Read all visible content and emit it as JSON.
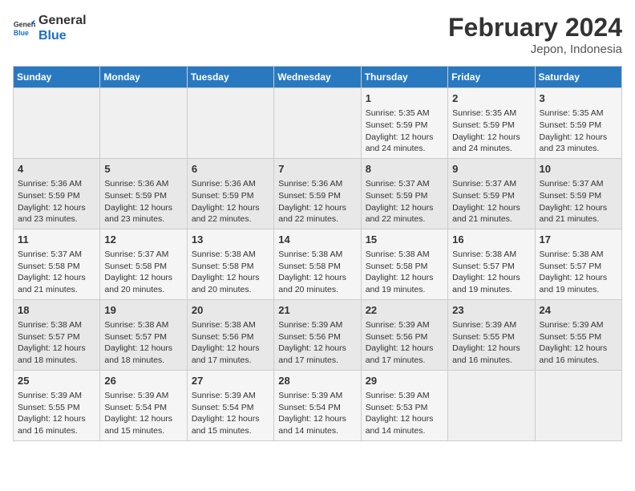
{
  "header": {
    "logo_line1": "General",
    "logo_line2": "Blue",
    "title": "February 2024",
    "subtitle": "Jepon, Indonesia"
  },
  "days_of_week": [
    "Sunday",
    "Monday",
    "Tuesday",
    "Wednesday",
    "Thursday",
    "Friday",
    "Saturday"
  ],
  "weeks": [
    [
      {
        "day": "",
        "info": ""
      },
      {
        "day": "",
        "info": ""
      },
      {
        "day": "",
        "info": ""
      },
      {
        "day": "",
        "info": ""
      },
      {
        "day": "1",
        "info": "Sunrise: 5:35 AM\nSunset: 5:59 PM\nDaylight: 12 hours\nand 24 minutes."
      },
      {
        "day": "2",
        "info": "Sunrise: 5:35 AM\nSunset: 5:59 PM\nDaylight: 12 hours\nand 24 minutes."
      },
      {
        "day": "3",
        "info": "Sunrise: 5:35 AM\nSunset: 5:59 PM\nDaylight: 12 hours\nand 23 minutes."
      }
    ],
    [
      {
        "day": "4",
        "info": "Sunrise: 5:36 AM\nSunset: 5:59 PM\nDaylight: 12 hours\nand 23 minutes."
      },
      {
        "day": "5",
        "info": "Sunrise: 5:36 AM\nSunset: 5:59 PM\nDaylight: 12 hours\nand 23 minutes."
      },
      {
        "day": "6",
        "info": "Sunrise: 5:36 AM\nSunset: 5:59 PM\nDaylight: 12 hours\nand 22 minutes."
      },
      {
        "day": "7",
        "info": "Sunrise: 5:36 AM\nSunset: 5:59 PM\nDaylight: 12 hours\nand 22 minutes."
      },
      {
        "day": "8",
        "info": "Sunrise: 5:37 AM\nSunset: 5:59 PM\nDaylight: 12 hours\nand 22 minutes."
      },
      {
        "day": "9",
        "info": "Sunrise: 5:37 AM\nSunset: 5:59 PM\nDaylight: 12 hours\nand 21 minutes."
      },
      {
        "day": "10",
        "info": "Sunrise: 5:37 AM\nSunset: 5:59 PM\nDaylight: 12 hours\nand 21 minutes."
      }
    ],
    [
      {
        "day": "11",
        "info": "Sunrise: 5:37 AM\nSunset: 5:58 PM\nDaylight: 12 hours\nand 21 minutes."
      },
      {
        "day": "12",
        "info": "Sunrise: 5:37 AM\nSunset: 5:58 PM\nDaylight: 12 hours\nand 20 minutes."
      },
      {
        "day": "13",
        "info": "Sunrise: 5:38 AM\nSunset: 5:58 PM\nDaylight: 12 hours\nand 20 minutes."
      },
      {
        "day": "14",
        "info": "Sunrise: 5:38 AM\nSunset: 5:58 PM\nDaylight: 12 hours\nand 20 minutes."
      },
      {
        "day": "15",
        "info": "Sunrise: 5:38 AM\nSunset: 5:58 PM\nDaylight: 12 hours\nand 19 minutes."
      },
      {
        "day": "16",
        "info": "Sunrise: 5:38 AM\nSunset: 5:57 PM\nDaylight: 12 hours\nand 19 minutes."
      },
      {
        "day": "17",
        "info": "Sunrise: 5:38 AM\nSunset: 5:57 PM\nDaylight: 12 hours\nand 19 minutes."
      }
    ],
    [
      {
        "day": "18",
        "info": "Sunrise: 5:38 AM\nSunset: 5:57 PM\nDaylight: 12 hours\nand 18 minutes."
      },
      {
        "day": "19",
        "info": "Sunrise: 5:38 AM\nSunset: 5:57 PM\nDaylight: 12 hours\nand 18 minutes."
      },
      {
        "day": "20",
        "info": "Sunrise: 5:38 AM\nSunset: 5:56 PM\nDaylight: 12 hours\nand 17 minutes."
      },
      {
        "day": "21",
        "info": "Sunrise: 5:39 AM\nSunset: 5:56 PM\nDaylight: 12 hours\nand 17 minutes."
      },
      {
        "day": "22",
        "info": "Sunrise: 5:39 AM\nSunset: 5:56 PM\nDaylight: 12 hours\nand 17 minutes."
      },
      {
        "day": "23",
        "info": "Sunrise: 5:39 AM\nSunset: 5:55 PM\nDaylight: 12 hours\nand 16 minutes."
      },
      {
        "day": "24",
        "info": "Sunrise: 5:39 AM\nSunset: 5:55 PM\nDaylight: 12 hours\nand 16 minutes."
      }
    ],
    [
      {
        "day": "25",
        "info": "Sunrise: 5:39 AM\nSunset: 5:55 PM\nDaylight: 12 hours\nand 16 minutes."
      },
      {
        "day": "26",
        "info": "Sunrise: 5:39 AM\nSunset: 5:54 PM\nDaylight: 12 hours\nand 15 minutes."
      },
      {
        "day": "27",
        "info": "Sunrise: 5:39 AM\nSunset: 5:54 PM\nDaylight: 12 hours\nand 15 minutes."
      },
      {
        "day": "28",
        "info": "Sunrise: 5:39 AM\nSunset: 5:54 PM\nDaylight: 12 hours\nand 14 minutes."
      },
      {
        "day": "29",
        "info": "Sunrise: 5:39 AM\nSunset: 5:53 PM\nDaylight: 12 hours\nand 14 minutes."
      },
      {
        "day": "",
        "info": ""
      },
      {
        "day": "",
        "info": ""
      }
    ]
  ]
}
